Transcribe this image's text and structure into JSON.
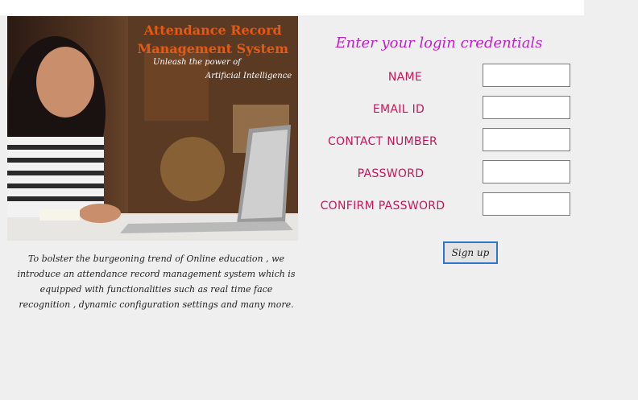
{
  "hero": {
    "title_line1": "Attendance Record",
    "title_line2": "Management System",
    "tagline_line1": "Unleash the power of",
    "tagline_line2": "Artificial Intelligence"
  },
  "description": "To bolster the burgeoning trend of Online education , we introduce an attendance record management system which is equipped with functionalities such as real time face recognition , dynamic configuration settings and many more.",
  "form": {
    "heading": "Enter your login credentials",
    "name_label": "NAME",
    "email_label": "EMAIL ID",
    "contact_label": "CONTACT NUMBER",
    "password_label": "PASSWORD",
    "confirm_label": "CONFIRM PASSWORD",
    "name_value": "",
    "email_value": "",
    "contact_value": "",
    "password_value": "",
    "confirm_value": "",
    "signup_label": "Sign up"
  },
  "colors": {
    "heading": "#c01fce",
    "label": "#c2185b",
    "hero_title": "#e35a16",
    "button_border": "#2d76c8"
  }
}
